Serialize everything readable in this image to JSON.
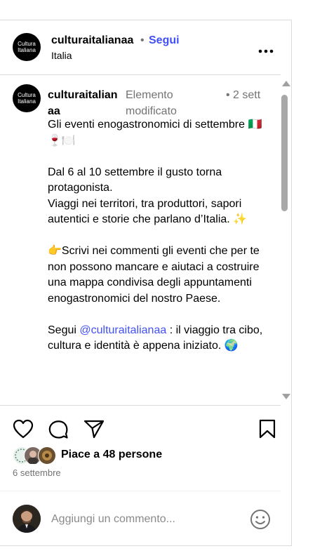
{
  "header": {
    "avatar_line1": "Cultura",
    "avatar_line2": "Italiana",
    "username": "culturaitalianaa",
    "dot": "•",
    "follow_label": "Segui",
    "location": "Italia",
    "more_label": "•••"
  },
  "caption": {
    "avatar_line1": "Cultura",
    "avatar_line2": "Italiana",
    "username": "culturaitalianaa",
    "edited": "Elemento modificato",
    "time": "• 2 sett",
    "lines": {
      "l1": "Gli eventi enogastronomici di settembre 🇮🇹🍷🍽️",
      "l2": "Dal 6 al 10 settembre il gusto torna protagonista.",
      "l3": "Viaggi nei territori, tra produttori, sapori autentici e storie che parlano d’Italia. ✨",
      "l4": "👉Scrivi nei commenti gli eventi che per te non possono mancare e aiutaci a costruire una mappa condivisa degli appuntamenti enogastronomici del nostro Paese.",
      "l5_prefix": "Segui ",
      "l5_mention": "@culturaitalianaa",
      "l5_suffix": " : il viaggio tra cibo, cultura e identità è appena iniziato. 🌍"
    }
  },
  "actions": {
    "like": "heart-icon",
    "comment": "speech-bubble-icon",
    "share": "paper-plane-icon",
    "save": "bookmark-icon"
  },
  "likes": {
    "text": "Piace a 48 persone"
  },
  "date": "6 settembre",
  "comment_box": {
    "placeholder": "Aggiungi un commento...",
    "emoji_icon": "smiley-icon"
  },
  "colors": {
    "accent": "#4150f7",
    "muted": "#737373",
    "border": "#dbdbdb"
  }
}
